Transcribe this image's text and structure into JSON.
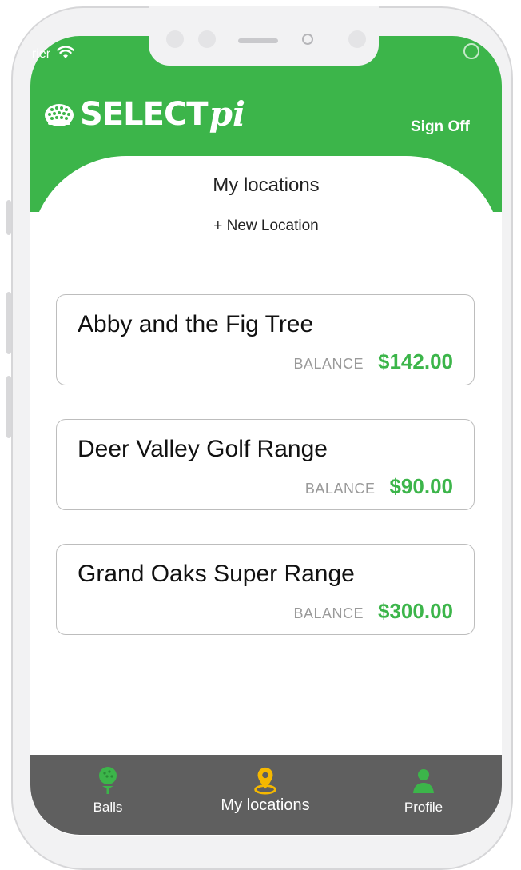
{
  "status": {
    "carrier": "rier"
  },
  "header": {
    "logo_text": "SELECT",
    "logo_suffix": "pi",
    "sign_off": "Sign Off"
  },
  "page": {
    "title": "My locations",
    "new_location": "+ New Location"
  },
  "locations": [
    {
      "name": "Abby and the Fig Tree",
      "balance_label": "BALANCE",
      "balance": "$142.00"
    },
    {
      "name": "Deer Valley Golf Range",
      "balance_label": "BALANCE",
      "balance": "$90.00"
    },
    {
      "name": "Grand Oaks Super Range",
      "balance_label": "BALANCE",
      "balance": "$300.00"
    }
  ],
  "tabbar": {
    "tabs": [
      {
        "label": "Balls",
        "icon": "golf-ball-on-tee-icon"
      },
      {
        "label": "My locations",
        "icon": "location-pin-icon",
        "active": true
      },
      {
        "label": "Profile",
        "icon": "person-icon"
      }
    ]
  },
  "colors": {
    "brand_green": "#3cb54a",
    "active_tab": "#f5b800",
    "tabbar_bg": "#5f5f5f"
  }
}
